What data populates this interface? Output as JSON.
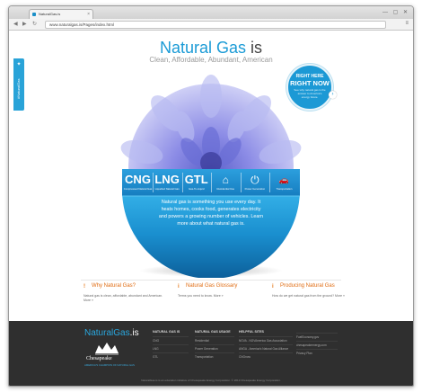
{
  "browser": {
    "tab_title": "NaturalGas.is",
    "url": "www.naturalgas.is/Pages/index.html",
    "back_glyph": "◀",
    "forward_glyph": "▶",
    "reload_glyph": "↻",
    "menu_glyph": "≡",
    "close_glyph": "×"
  },
  "share": {
    "label": "#NaturalGas",
    "icon": "twitter-icon"
  },
  "hero": {
    "title_part1": "Natural Gas",
    "title_part2": " is",
    "subtitle": "Clean, Affordable, Abundant, American"
  },
  "right_here": {
    "line1": "RIGHT HERE",
    "line2": "RIGHT NOW",
    "line3": "See why natural gas is the answer to America's energy future."
  },
  "band": [
    {
      "abbr": "CNG",
      "caption": "Compressed Natural Gas"
    },
    {
      "abbr": "LNG",
      "caption": "Liquefied Natural Gas"
    },
    {
      "abbr": "GTL",
      "caption": "Gas-To-Liquid"
    },
    {
      "glyph": "⌂",
      "caption": "Residential Use",
      "icon": "house-icon"
    },
    {
      "glyph": "⏻",
      "caption": "Power Generation",
      "icon": "power-outlet-icon"
    },
    {
      "glyph": "🚗",
      "caption": "Transportation",
      "icon": "car-icon"
    }
  ],
  "orb_text": "Natural gas is something you use every day. It heats homes, cooks food, generates electricity and powers a growing number of vehicles. Learn more about what natural gas is.",
  "features": [
    {
      "icon": "!",
      "title": "Why Natural Gas?",
      "desc": "Natural gas is clean, affordable, abundant and American. More »"
    },
    {
      "icon": "i",
      "title": "Natural Gas Glossary",
      "desc": "Terms you need to know. More »"
    },
    {
      "icon": "i",
      "title": "Producing Natural Gas",
      "desc": "How do we get natural gas from the ground? More »"
    }
  ],
  "footer": {
    "logo_text": "NaturalGas",
    "logo_is": ".is",
    "company": "Chesapeake",
    "tagline": "AMERICA'S CHAMPION OF NATURAL GAS",
    "columns": [
      {
        "heading": "NATURAL GAS IS",
        "items": [
          "CNG",
          "LNG",
          "GTL"
        ]
      },
      {
        "heading": "NATURAL GAS USAGE",
        "items": [
          "Residential",
          "Power Generation",
          "Transportation"
        ]
      },
      {
        "heading": "HELPFUL SITES",
        "items": [
          "NGVA - NGVAmerica Gas Association",
          "ANGA - America's Natural Gas Alliance",
          "CNGnow"
        ]
      },
      {
        "heading": "",
        "items": [
          "FuelEconomy.gov",
          "chesapeakeenergy.com",
          "Privacy Plan"
        ]
      }
    ],
    "copyright": "NaturalGas.is is an education initiative of Chesapeake Energy Corporation. © 2013 Chesapeake Energy Corporation."
  },
  "colors": {
    "brand_blue": "#1b9bd6",
    "accent_orange": "#e06c12",
    "footer_bg": "#2f2f2f"
  }
}
